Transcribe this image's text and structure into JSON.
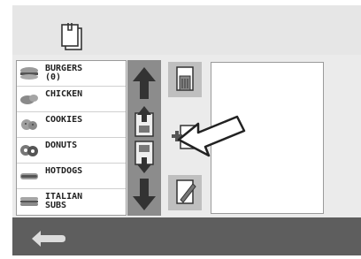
{
  "list": {
    "items": [
      {
        "label": "BURGERS\n(0)",
        "icon": "burger-icon"
      },
      {
        "label": "CHICKEN",
        "icon": "chicken-icon"
      },
      {
        "label": "COOKIES",
        "icon": "cookie-icon"
      },
      {
        "label": "DONUTS",
        "icon": "donut-icon"
      },
      {
        "label": "HOTDOGS",
        "icon": "hotdog-icon"
      },
      {
        "label": "ITALIAN\nSUBS",
        "icon": "sub-sandwich-icon"
      }
    ]
  },
  "icons": {
    "header": "documents-icon",
    "up": "arrow-up-icon",
    "down": "arrow-down-icon",
    "move_up": "move-item-up-icon",
    "move_down": "move-item-down-icon",
    "delete": "delete-document-icon",
    "add": "add-document-icon",
    "edit": "edit-document-icon",
    "back": "back-arrow-icon",
    "pointer": "pointer-arrow-icon"
  },
  "colors": {
    "list_bg": "#ffffff",
    "panel_bg": "#ffffff",
    "bottom_bar": "#5e5e5e",
    "arrow_column": "#8c8c8c"
  }
}
